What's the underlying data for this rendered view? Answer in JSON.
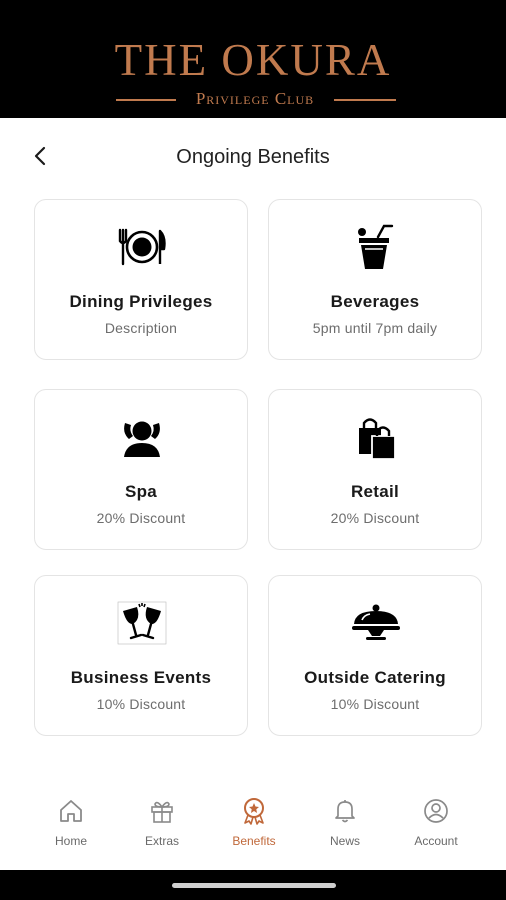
{
  "brand": {
    "title": "THE OKURA",
    "subtitle": "Privilege Club",
    "color": "#c07a4e"
  },
  "header": {
    "title": "Ongoing Benefits",
    "back_icon": "chevron-left-icon"
  },
  "benefits": [
    {
      "title": "Dining Privileges",
      "description": "Description",
      "icon": "dining-icon"
    },
    {
      "title": "Beverages",
      "description": "5pm until 7pm daily",
      "icon": "beverage-icon"
    },
    {
      "title": "Spa",
      "description": "20% Discount",
      "icon": "spa-icon"
    },
    {
      "title": "Retail",
      "description": "20% Discount",
      "icon": "shopping-bags-icon"
    },
    {
      "title": "Business Events",
      "description": "10% Discount",
      "icon": "toast-glasses-icon"
    },
    {
      "title": "Outside Catering",
      "description": "10% Discount",
      "icon": "cloche-icon"
    }
  ],
  "bottom_nav": {
    "active": "Benefits",
    "active_color": "#c0683a",
    "items": [
      {
        "label": "Home",
        "icon": "home-icon"
      },
      {
        "label": "Extras",
        "icon": "gift-icon"
      },
      {
        "label": "Benefits",
        "icon": "badge-icon"
      },
      {
        "label": "News",
        "icon": "bell-icon"
      },
      {
        "label": "Account",
        "icon": "user-circle-icon"
      }
    ]
  }
}
